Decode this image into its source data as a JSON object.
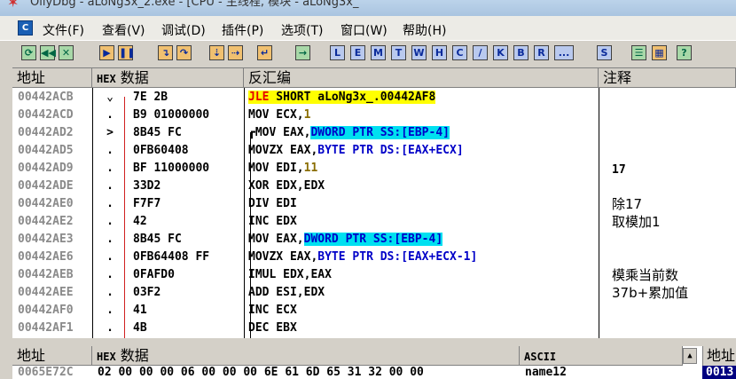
{
  "window": {
    "title": "OllyDbg - aLoNg3x_2.exe - [CPU - 主线程, 模块 - aLoNg3x_"
  },
  "menu": [
    {
      "label": "文件(F)"
    },
    {
      "label": "查看(V)"
    },
    {
      "label": "调试(D)"
    },
    {
      "label": "插件(P)"
    },
    {
      "label": "选项(T)"
    },
    {
      "label": "窗口(W)"
    },
    {
      "label": "帮助(H)"
    }
  ],
  "toolbar_letters": [
    "L",
    "E",
    "M",
    "T",
    "W",
    "H",
    "C",
    "/",
    "K",
    "B",
    "R",
    "...",
    "S"
  ],
  "columns": {
    "addr": "地址",
    "hex_prefix": "HEX",
    "hex": "数据",
    "disasm": "反汇编",
    "comment": "注释"
  },
  "rows": [
    {
      "addr": "00442ACB",
      "mark": "⌄",
      "hex": "7E 2B",
      "dis_op": "JLE",
      "dis_rest": " SHORT aLoNg3x_.00442AF8",
      "comment": ""
    },
    {
      "addr": "00442ACD",
      "mark": ".",
      "hex": "B9 01000000",
      "dis_a": "MOV ECX,",
      "dis_num": "1",
      "comment": ""
    },
    {
      "addr": "00442AD2",
      "mark": ">",
      "hex": "8B45 FC",
      "dis_a": "MOV EAX,",
      "dis_hl": "DWORD PTR SS:[EBP-4]",
      "comment": ""
    },
    {
      "addr": "00442AD5",
      "mark": ".",
      "hex": "0FB60408",
      "dis_a": "MOVZX EAX,",
      "dis_mem": "BYTE PTR DS:[EAX+ECX]",
      "comment": ""
    },
    {
      "addr": "00442AD9",
      "mark": ".",
      "hex": "BF 11000000",
      "dis_a": "MOV EDI,",
      "dis_num": "11",
      "comment": "17"
    },
    {
      "addr": "00442ADE",
      "mark": ".",
      "hex": "33D2",
      "dis_a": "XOR EDX,EDX",
      "comment": ""
    },
    {
      "addr": "00442AE0",
      "mark": ".",
      "hex": "F7F7",
      "dis_a": "DIV EDI",
      "comment": "除17"
    },
    {
      "addr": "00442AE2",
      "mark": ".",
      "hex": "42",
      "dis_a": "INC EDX",
      "comment": "取模加1"
    },
    {
      "addr": "00442AE3",
      "mark": ".",
      "hex": "8B45 FC",
      "dis_a": "MOV EAX,",
      "dis_hl": "DWORD PTR SS:[EBP-4]",
      "comment": ""
    },
    {
      "addr": "00442AE6",
      "mark": ".",
      "hex": "0FB64408 FF",
      "dis_a": "MOVZX EAX,",
      "dis_mem": "BYTE PTR DS:[EAX+ECX-1]",
      "comment": ""
    },
    {
      "addr": "00442AEB",
      "mark": ".",
      "hex": "0FAFD0",
      "dis_a": "IMUL EDX,EAX",
      "comment": "模乘当前数"
    },
    {
      "addr": "00442AEE",
      "mark": ".",
      "hex": "03F2",
      "dis_a": "ADD ESI,EDX",
      "comment": "37b+累加值"
    },
    {
      "addr": "00442AF0",
      "mark": ".",
      "hex": "41",
      "dis_a": "INC ECX",
      "comment": ""
    },
    {
      "addr": "00442AF1",
      "mark": ".",
      "hex": "4B",
      "dis_a": "DEC EBX",
      "comment": ""
    }
  ],
  "dump": {
    "addr_label": "地址",
    "hex_prefix": "HEX",
    "hex_label": "数据",
    "ascii_label": "ASCII",
    "row_addr": "0065E72C",
    "row_hex": "02 00 00 00 06 00 00 00 6E 61 6D 65 31 32 00 00",
    "row_ascii": "       name12"
  },
  "stack": {
    "label": "地址",
    "value": "0013"
  }
}
